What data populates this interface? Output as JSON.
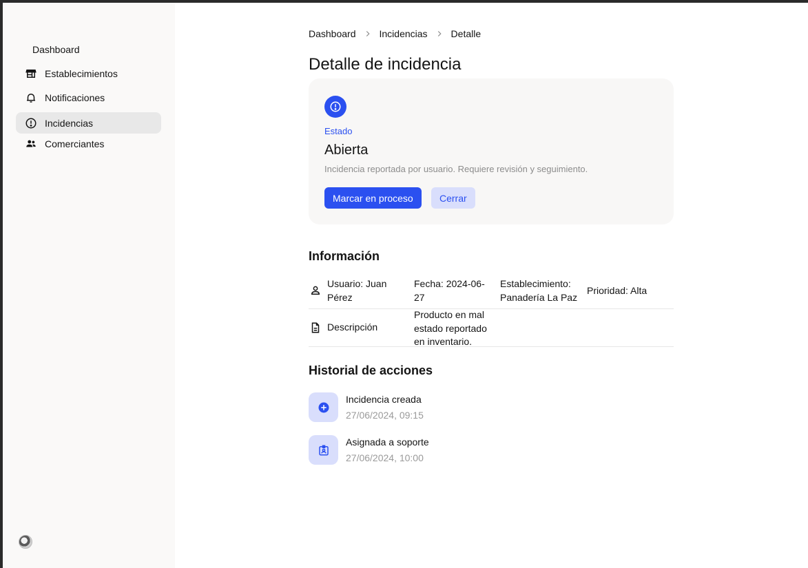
{
  "sidebar": {
    "title": "Dashboard",
    "items": [
      {
        "label": "Establecimientos",
        "icon": "store-icon",
        "active": false
      },
      {
        "label": "Notificaciones",
        "icon": "bell-icon",
        "active": false
      },
      {
        "label": "Incidencias",
        "icon": "alert-circle-icon",
        "active": true
      },
      {
        "label": "Comerciantes",
        "icon": "people-icon",
        "active": false
      }
    ],
    "avatar_icon": "user-avatar"
  },
  "breadcrumb": {
    "items": [
      "Dashboard",
      "Incidencias",
      "Detalle"
    ]
  },
  "page": {
    "title": "Detalle de incidencia"
  },
  "status": {
    "icon": "alert-circle-icon",
    "label": "Estado",
    "value": "Abierta",
    "description": "Incidencia reportada por usuario. Requiere revisión y seguimiento.",
    "primary_action": "Marcar en proceso",
    "secondary_action": "Cerrar"
  },
  "info": {
    "title": "Información",
    "user": "Usuario: Juan Pérez",
    "date": "Fecha: 2024-06-27",
    "establishment": "Establecimiento: Panadería La Paz",
    "priority": "Prioridad: Alta",
    "description_label": "Descripción",
    "description_value": "Producto en mal estado reportado en inventario."
  },
  "history": {
    "title": "Historial de acciones",
    "items": [
      {
        "title": "Incidencia creada",
        "time": "27/06/2024, 09:15",
        "icon": "plus-circle-icon"
      },
      {
        "title": "Asignada a soporte",
        "time": "27/06/2024, 10:00",
        "icon": "badge-icon"
      }
    ]
  },
  "colors": {
    "accent": "#2b50f0",
    "accent_soft": "#d9defc",
    "sidebar_bg": "#faf9f8",
    "card_bg": "#f8f7f6",
    "muted_text": "#8c8c8c"
  }
}
